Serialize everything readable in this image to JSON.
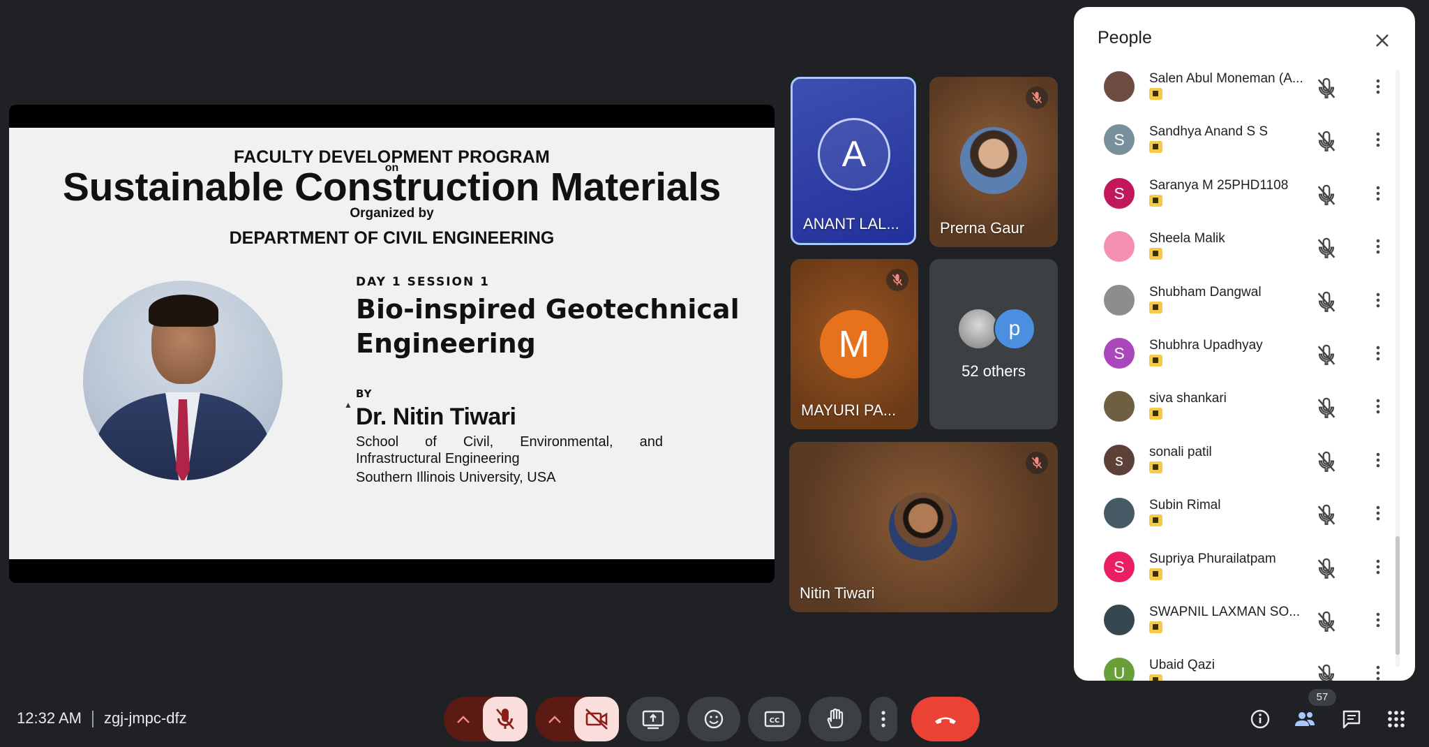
{
  "slide": {
    "heading": "FACULTY DEVELOPMENT PROGRAM",
    "on": "on",
    "title": "Sustainable Construction Materials",
    "organized_by": "Organized by",
    "department": "DEPARTMENT OF CIVIL ENGINEERING",
    "session": "DAY 1 SESSION 1",
    "talk_title": "Bio-inspired Geotechnical Engineering",
    "by": "BY",
    "speaker": "Dr. Nitin Tiwari",
    "affiliation_line1": "School of Civil, Environmental, and",
    "affiliation_line2": "Infrastructural Engineering",
    "affiliation_line3": "Southern Illinois University, USA"
  },
  "tiles": {
    "t1": {
      "initial": "A",
      "name": "ANANT LAL..."
    },
    "t2": {
      "name": "Prerna Gaur"
    },
    "t3": {
      "initial": "M",
      "name": "MAYURI PA..."
    },
    "t4": {
      "avatar_letter": "p",
      "others": "52 others"
    },
    "t5": {
      "name": "Nitin Tiwari"
    }
  },
  "panel": {
    "title": "People",
    "participants": [
      {
        "name": "Salen Abul Moneman (A...",
        "initial": "",
        "color": "#6d4c41"
      },
      {
        "name": "Sandhya Anand S S",
        "initial": "S",
        "color": "#78909c"
      },
      {
        "name": "Saranya M 25PHD1108",
        "initial": "S",
        "color": "#c2185b"
      },
      {
        "name": "Sheela Malik",
        "initial": "",
        "color": "#f48fb1"
      },
      {
        "name": "Shubham Dangwal",
        "initial": "",
        "color": "#8d8d8d"
      },
      {
        "name": "Shubhra Upadhyay",
        "initial": "S",
        "color": "#ab47bc"
      },
      {
        "name": "siva shankari",
        "initial": "",
        "color": "#6d5f3f"
      },
      {
        "name": "sonali patil",
        "initial": "s",
        "color": "#5d4037"
      },
      {
        "name": "Subin Rimal",
        "initial": "",
        "color": "#455a64"
      },
      {
        "name": "Supriya Phurailatpam",
        "initial": "S",
        "color": "#e91e63"
      },
      {
        "name": "SWAPNIL LAXMAN SO...",
        "initial": "",
        "color": "#37474f"
      },
      {
        "name": "Ubaid Qazi",
        "initial": "U",
        "color": "#689f38"
      }
    ]
  },
  "bottom": {
    "time": "12:32 AM",
    "meeting_code": "zgj-jmpc-dfz",
    "participant_count": "57"
  }
}
